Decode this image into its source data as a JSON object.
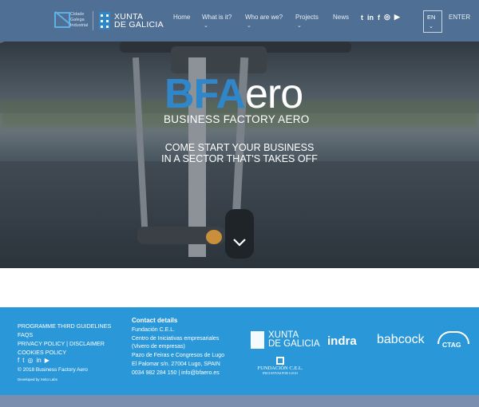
{
  "header": {
    "logo_lines": [
      "Cidade",
      "Galega",
      "Industrial"
    ],
    "xunta_lines": [
      "XUNTA",
      "DE GALICIA"
    ],
    "nav": [
      {
        "label": "Home",
        "caret": ""
      },
      {
        "label": "What is it?",
        "caret": "⌄"
      },
      {
        "label": "Who are we?",
        "caret": "⌄"
      },
      {
        "label": "Projects",
        "caret": "⌄"
      },
      {
        "label": "News",
        "caret": ""
      }
    ],
    "social_icons": [
      "twitter-icon",
      "linkedin-icon",
      "facebook-icon",
      "instagram-icon",
      "youtube-icon"
    ],
    "social_glyphs": [
      "t",
      "in",
      "f",
      "◎",
      "▶"
    ],
    "language": "EN",
    "language_caret": "⌄",
    "enter_label": "ENTER"
  },
  "hero": {
    "title_part1": "BFA",
    "title_part2": "ero",
    "subtitle": "BUSINESS FACTORY AERO",
    "tagline_line1": "COME START YOUR BUSINESS",
    "tagline_line2": "IN A SECTOR THAT'S TAKES OFF"
  },
  "footer": {
    "links": [
      "PROGRAMME THIRD GUIDELINES",
      "FAQS",
      "PRIVACY POLICY",
      "DISCLAIMER",
      "COOKIES POLICY"
    ],
    "link_separator": "|",
    "social_glyphs": [
      "f",
      "t",
      "◎",
      "in",
      "▶"
    ],
    "copyright": "© 2018 Business Factory Aero",
    "developed_by": "Developed by Xeito Labs",
    "contact": {
      "heading": "Contact details",
      "lines": [
        "Fundación C.E.L.",
        "Centro de Iniciativas empresariales",
        "(Vivero de empresas)",
        "Pazo de Feiras e Congresos de Lugo",
        "El Palomar s/n. 27004 Lugo, SPAIN",
        "0034 982 284 150 | info@bfaero.es"
      ]
    },
    "partners": {
      "xunta": [
        "XUNTA",
        "DE GALICIA"
      ],
      "indra": "indra",
      "babcock": "babcock",
      "ctag": "CTAG",
      "cel_line1": "FUNDACIÓN C.E.L.",
      "cel_line2": "INICIATIVAS POR LUGO"
    }
  },
  "colors": {
    "header_bg": "#4f6f95",
    "brand_blue": "#2f86c8",
    "footer_bg": "#2a97d8",
    "bottom_band": "#7a8fb0"
  }
}
